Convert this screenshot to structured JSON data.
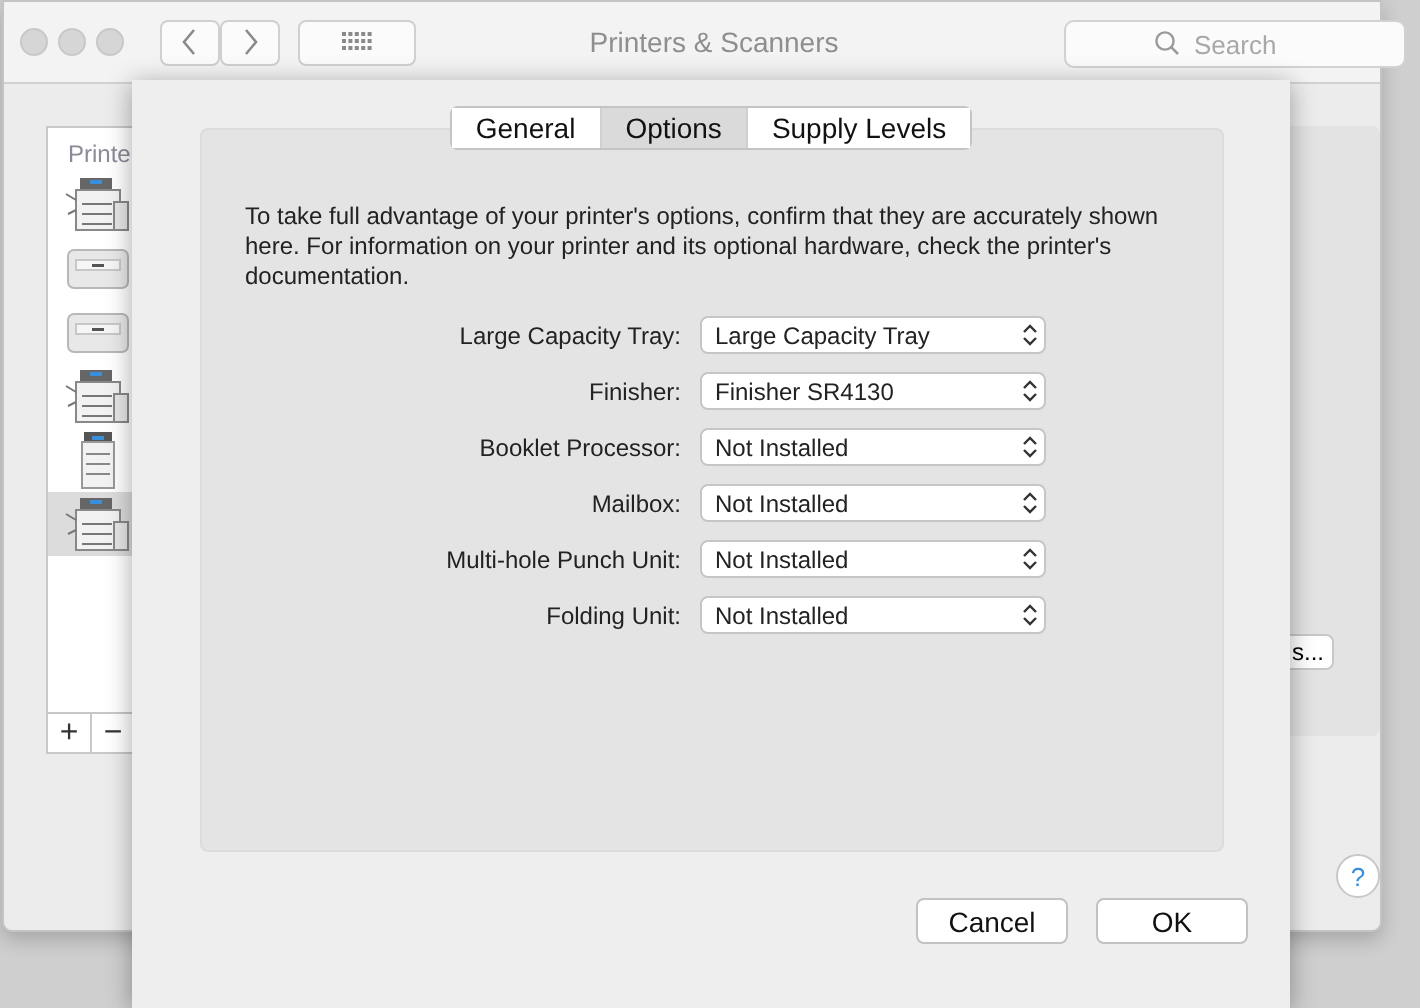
{
  "window": {
    "title": "Printers & Scanners",
    "search": {
      "placeholder": "Search"
    }
  },
  "printer_list": {
    "header": "Printe",
    "items": [
      {
        "kind": "mfp",
        "selected": false
      },
      {
        "kind": "laser",
        "selected": false
      },
      {
        "kind": "laser",
        "selected": false
      },
      {
        "kind": "mfp",
        "selected": false
      },
      {
        "kind": "tower",
        "selected": false
      },
      {
        "kind": "mfp",
        "selected": true
      }
    ],
    "add_button": "+",
    "remove_button": "−"
  },
  "background_button": "s...",
  "sheet": {
    "tabs": [
      {
        "label": "General",
        "selected": false
      },
      {
        "label": "Options",
        "selected": true
      },
      {
        "label": "Supply Levels",
        "selected": false
      }
    ],
    "description": "To take full advantage of your printer's options, confirm that they are accurately shown here. For information on your printer and its optional hardware, check the printer's documentation.",
    "options": [
      {
        "label": "Large Capacity Tray:",
        "value": "Large Capacity Tray"
      },
      {
        "label": "Finisher:",
        "value": "Finisher SR4130"
      },
      {
        "label": "Booklet Processor:",
        "value": "Not Installed"
      },
      {
        "label": "Mailbox:",
        "value": "Not Installed"
      },
      {
        "label": "Multi-hole Punch Unit:",
        "value": "Not Installed"
      },
      {
        "label": "Folding Unit:",
        "value": "Not Installed"
      }
    ],
    "buttons": [
      {
        "label": "Cancel",
        "default": false
      },
      {
        "label": "OK",
        "default": false
      }
    ]
  },
  "help_button": "?"
}
